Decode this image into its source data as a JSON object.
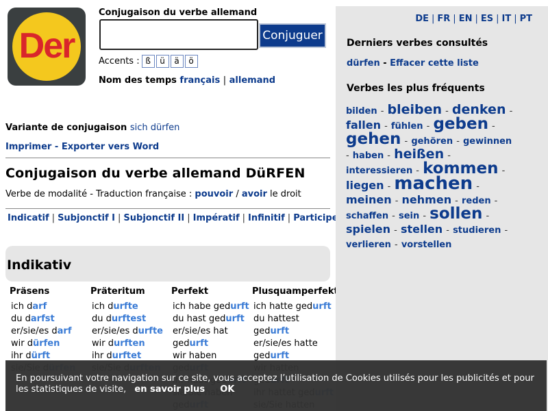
{
  "logo": {
    "text": "Der"
  },
  "search": {
    "title": "Conjugaison du verbe allemand",
    "placeholder": "",
    "button": "Conjuguer",
    "accents_label": "Accents :",
    "accents": [
      "ß",
      "ü",
      "ä",
      "ö"
    ]
  },
  "tense_names": {
    "label": "Nom des temps",
    "fr": "français",
    "sep": "|",
    "de": "allemand"
  },
  "variant": {
    "label": "Variante de conjugaison",
    "link": "sich dürfen"
  },
  "print": {
    "print": "Imprimer",
    "sep": "-",
    "export": "Exporter vers Word"
  },
  "page_title": "Conjugaison du verbe allemand DüRFEN",
  "verb_info": {
    "prefix": "Verbe de modalité - Traduction française :",
    "t1": "pouvoir",
    "slash": "/",
    "t2": "avoir",
    "suffix": "le droit"
  },
  "moods": [
    "Indicatif",
    "Subjonctif I",
    "Subjonctif II",
    "Impératif",
    "Infinitif",
    "Participe"
  ],
  "mood_sep": "|",
  "section_title": "Indikativ",
  "tenses": [
    {
      "name": "Präsens",
      "rows": [
        {
          "stem": "ich d",
          "end": "arf"
        },
        {
          "stem": "du d",
          "end": "arfst"
        },
        {
          "stem": "er/sie/es d",
          "end": "arf"
        },
        {
          "stem": "wir d",
          "end": "ürfen"
        },
        {
          "stem": "ihr d",
          "end": "ürft"
        },
        {
          "stem": "sie/Sie d",
          "end": "ürfen"
        }
      ]
    },
    {
      "name": "Präteritum",
      "rows": [
        {
          "stem": "ich d",
          "end": "urfte"
        },
        {
          "stem": "du d",
          "end": "urftest"
        },
        {
          "stem": "er/sie/es d",
          "end": "urfte"
        },
        {
          "stem": "wir d",
          "end": "urften"
        },
        {
          "stem": "ihr d",
          "end": "urftet"
        },
        {
          "stem": "sie/Sie d",
          "end": "urften"
        }
      ]
    },
    {
      "name": "Perfekt",
      "rows": [
        {
          "stem": "ich habe ged",
          "end": "urft"
        },
        {
          "stem": "du hast ged",
          "end": "urft"
        },
        {
          "stem": "er/sie/es hat",
          "end": ""
        },
        {
          "stem": "ged",
          "end": "urft"
        },
        {
          "stem": "wir haben",
          "end": ""
        },
        {
          "stem": "ged",
          "end": "urft"
        },
        {
          "stem": "ihr habt ged",
          "end": "urft"
        },
        {
          "stem": "sie/Sie haben",
          "end": ""
        },
        {
          "stem": "ged",
          "end": "urft"
        }
      ]
    },
    {
      "name": "Plusquamperfekt",
      "rows": [
        {
          "stem": "ich hatte ged",
          "end": "urft"
        },
        {
          "stem": "du hattest",
          "end": ""
        },
        {
          "stem": "ged",
          "end": "urft"
        },
        {
          "stem": "er/sie/es hatte",
          "end": ""
        },
        {
          "stem": "ged",
          "end": "urft"
        },
        {
          "stem": "wir hatten",
          "end": ""
        },
        {
          "stem": "ged",
          "end": "urft"
        },
        {
          "stem": "ihr hattet ged",
          "end": "urft"
        },
        {
          "stem": "sie/Sie hatten",
          "end": ""
        }
      ]
    }
  ],
  "sidebar": {
    "languages": [
      "DE",
      "FR",
      "EN",
      "ES",
      "IT",
      "PT"
    ],
    "lang_sep": "|",
    "recent_title": "Derniers verbes consultés",
    "recent_verb": "dürfen",
    "recent_sep": "-",
    "clear_list": "Effacer cette liste",
    "frequent_title": "Verbes les plus fréquents",
    "frequent": [
      {
        "w": "bilden",
        "s": 1
      },
      {
        "w": "bleiben",
        "s": 3
      },
      {
        "w": "denken",
        "s": 3
      },
      {
        "w": "fallen",
        "s": 2
      },
      {
        "w": "fühlen",
        "s": 1
      },
      {
        "w": "geben",
        "s": 4
      },
      {
        "w": "gehen",
        "s": 4
      },
      {
        "w": "gehören",
        "s": 1
      },
      {
        "w": "gewinnen",
        "s": 1
      },
      {
        "w": "haben",
        "s": 1
      },
      {
        "w": "heißen",
        "s": 3
      },
      {
        "w": "interessieren",
        "s": 1
      },
      {
        "w": "kommen",
        "s": 4
      },
      {
        "w": "liegen",
        "s": 2
      },
      {
        "w": "machen",
        "s": 5
      },
      {
        "w": "meinen",
        "s": 2
      },
      {
        "w": "nehmen",
        "s": 2
      },
      {
        "w": "reden",
        "s": 1
      },
      {
        "w": "schaffen",
        "s": 1
      },
      {
        "w": "sein",
        "s": 1
      },
      {
        "w": "sollen",
        "s": 4
      },
      {
        "w": "spielen",
        "s": 2
      },
      {
        "w": "stellen",
        "s": 2
      },
      {
        "w": "studieren",
        "s": 1
      },
      {
        "w": "verlieren",
        "s": 1
      },
      {
        "w": "vorstellen",
        "s": 1
      }
    ],
    "frequent_sep": "-"
  },
  "cookie": {
    "text": "En poursuivant votre navigation sur ce site, vous acceptez l’utilisation de Cookies utilisés pour les publicités et pour les statistiques de visite,",
    "more": "en savoir plus",
    "ok": "OK"
  },
  "colors": {
    "link": "#0d3b8c",
    "ending": "#3a7bd5",
    "logo_bg": "#3a3f40",
    "logo_disc": "#f4c81e",
    "logo_text": "#d9262b",
    "sidebar_bg": "#e6e6e6",
    "cookie_bg": "#333333"
  }
}
